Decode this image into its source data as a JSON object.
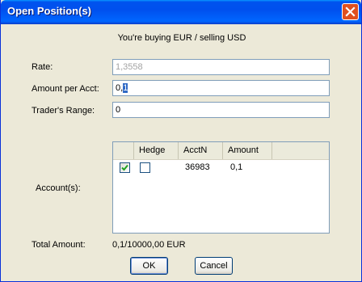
{
  "window": {
    "title": "Open Position(s)",
    "close_icon": "close-icon",
    "accent": "#0054e3"
  },
  "heading": "You're buying EUR / selling USD",
  "form": {
    "rate_label": "Rate:",
    "rate_value": "1,3558",
    "amount_label": "Amount per Acct:",
    "amount_value_prefix": "0,",
    "amount_value_selected": "1",
    "range_label": "Trader's Range:",
    "range_value": "0",
    "accounts_label": "Account(s):"
  },
  "accounts_table": {
    "columns": [
      "",
      "Hedge",
      "AcctN",
      "Amount"
    ],
    "rows": [
      {
        "selected": true,
        "hedge": false,
        "acct": "36983",
        "amount": "0,1"
      }
    ]
  },
  "total": {
    "label": "Total Amount:",
    "value": "0,1/10000,00 EUR"
  },
  "buttons": {
    "ok": "OK",
    "cancel": "Cancel"
  }
}
